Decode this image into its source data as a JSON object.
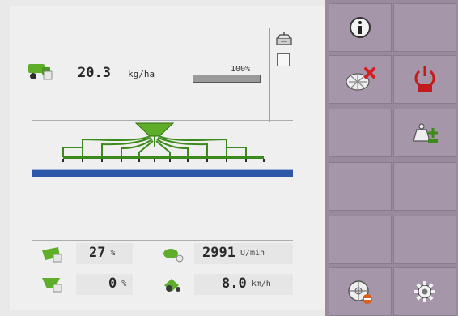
{
  "work": {
    "application_rate": {
      "value": "20.3",
      "unit": "kg/ha"
    },
    "rate_percent": {
      "label": "100%",
      "fill": 1.0
    }
  },
  "readings": {
    "left_top": {
      "value": "27",
      "unit": "%"
    },
    "left_bot": {
      "value": "0",
      "unit": "%"
    },
    "right_top": {
      "value": "2991",
      "unit": "U/min"
    },
    "right_bot": {
      "value": "8.0",
      "unit": "km/h"
    }
  },
  "softkeys": [
    {
      "name": "info-key",
      "icon": "info-icon"
    },
    {
      "name": "blank-key-1",
      "icon": ""
    },
    {
      "name": "spreader-off-key",
      "icon": "spreader-off-icon"
    },
    {
      "name": "power-key",
      "icon": "power-icon"
    },
    {
      "name": "blank-key-2",
      "icon": ""
    },
    {
      "name": "weigh-add-key",
      "icon": "weigh-add-icon"
    },
    {
      "name": "blank-key-3",
      "icon": ""
    },
    {
      "name": "blank-key-4",
      "icon": ""
    },
    {
      "name": "blank-key-5",
      "icon": ""
    },
    {
      "name": "blank-key-6",
      "icon": ""
    },
    {
      "name": "disc-key",
      "icon": "disc-icon"
    },
    {
      "name": "settings-key",
      "icon": "gear-icon"
    }
  ],
  "colors": {
    "accent_green": "#5fae2a",
    "boom_blue": "#2d57a9",
    "softkey_bg": "#a596a9"
  }
}
